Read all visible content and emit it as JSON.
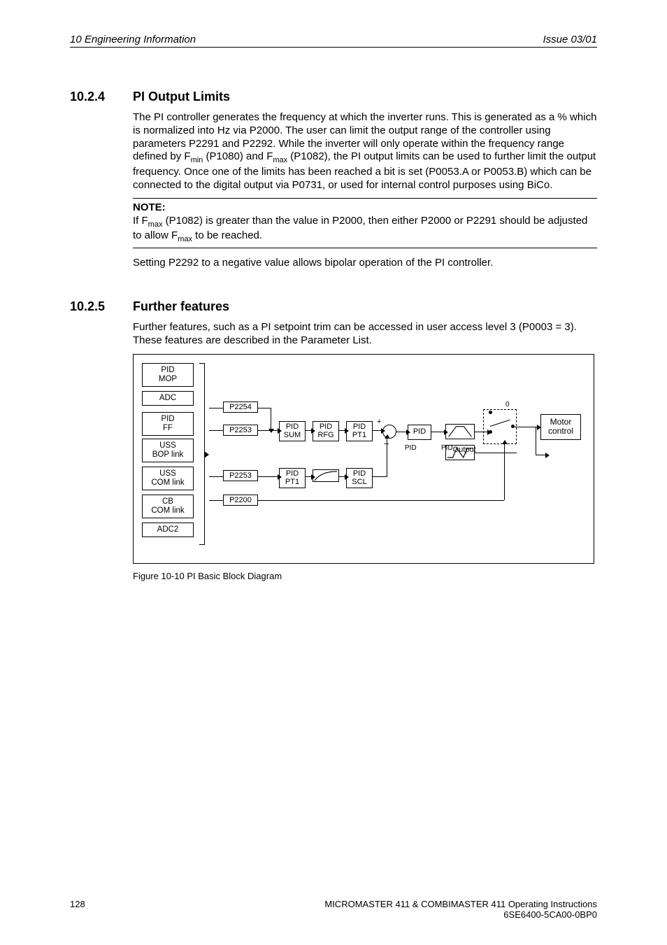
{
  "header": {
    "left": "10  Engineering Information",
    "right": "Issue 03/01"
  },
  "sections": {
    "s1": {
      "num": "10.2.4",
      "title": "PI Output Limits",
      "para1_a": "The PI controller generates the frequency at which the inverter runs. This is generated as a % which is normalized into Hz via P2000. The user can limit the output range of the controller using parameters P2291 and P2292. While the inverter will only operate within the frequency range defined by F",
      "para1_b": " (P1080) and F",
      "para1_c": " (P1082), the PI output limits can be used to further limit the output frequency. Once one of the limits has been reached a bit is set (P0053.A or P0053.B) which can be connected to the digital output via P0731, or used for internal control purposes using BiCo.",
      "note_label": "NOTE:",
      "note_a": "If F",
      "note_b": " (P1082) is greater than the value in P2000, then either P2000 or P2291 should be adjusted to allow F",
      "note_c": " to be reached.",
      "para2": "Setting P2292 to a negative value allows bipolar operation of the PI controller."
    },
    "s2": {
      "num": "10.2.5",
      "title": "Further features",
      "para1": "Further features, such as a PI setpoint trim can be accessed in user access level 3 (P0003 = 3). These features are described in the Parameter List."
    }
  },
  "diagram": {
    "src": {
      "b0": "PID\nMOP",
      "b1": "ADC",
      "b2": "PID\nFF",
      "b3": "USS\nBOP link",
      "b4": "USS\nCOM link",
      "b5": "CB\nCOM link",
      "b6": "ADC2"
    },
    "taps": {
      "t1": "P2254",
      "t2": "P2253",
      "t3": "P2253",
      "t4": "P2200"
    },
    "proc": {
      "sum": "PID\nSUM",
      "rfg": "PID\nRFG",
      "pt1a": "PID\nPT1",
      "pid": "PID",
      "pt1b": "PID\nPT1",
      "scl": "PID\nSCL"
    },
    "labels": {
      "pid_small": "PID",
      "pid_output": "PIDOutput",
      "zero": "0"
    },
    "motor": "Motor\ncontrol",
    "caption": "Figure 10-10  PI Basic Block Diagram"
  },
  "subscripts": {
    "min": "min",
    "max": "max",
    "output": "Output"
  },
  "footer": {
    "page": "128",
    "line1": "MICROMASTER 411 & COMBIMASTER 411     Operating Instructions",
    "line2": "6SE6400-5CA00-0BP0"
  }
}
